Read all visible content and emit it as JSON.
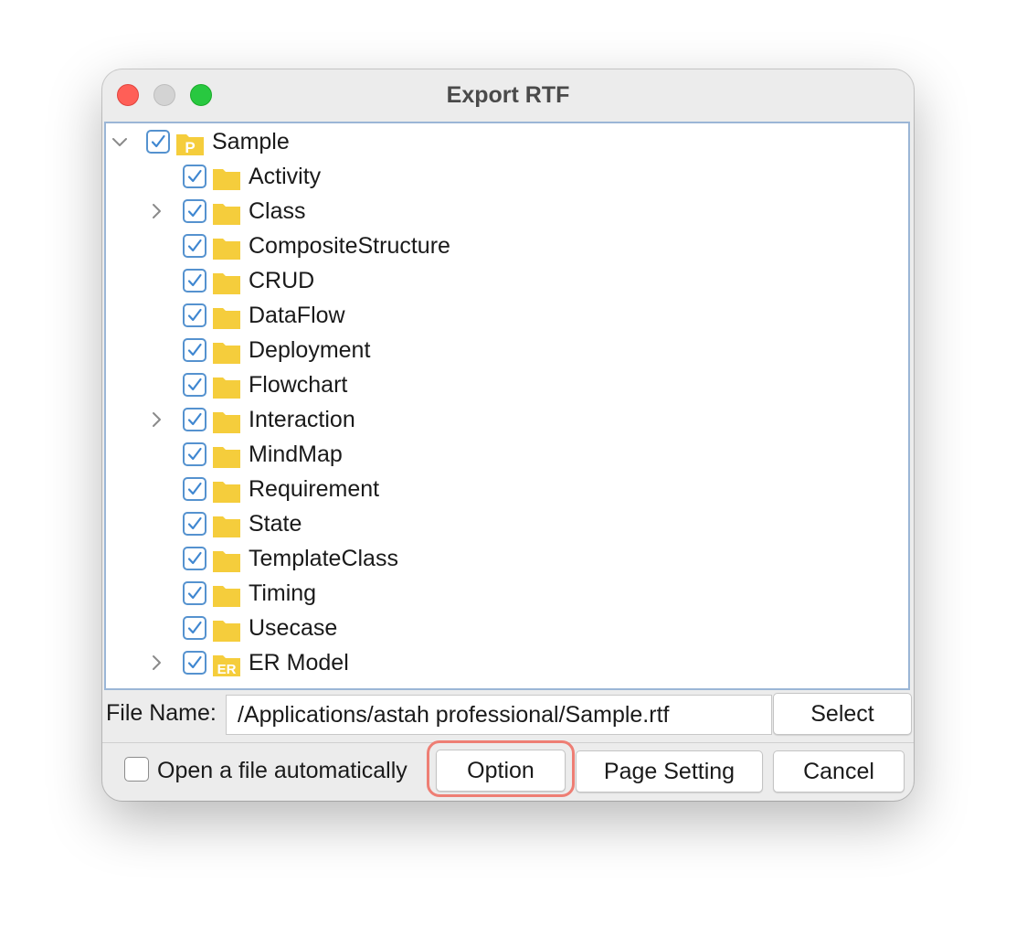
{
  "window": {
    "title": "Export RTF"
  },
  "tree": {
    "root": {
      "label": "Sample",
      "icon": "project-icon",
      "icon_letter": "P",
      "checked": true,
      "expanded": true
    },
    "items": [
      {
        "label": "Activity",
        "expandable": false,
        "checked": true,
        "icon": "folder-icon"
      },
      {
        "label": "Class",
        "expandable": true,
        "checked": true,
        "icon": "folder-icon"
      },
      {
        "label": "CompositeStructure",
        "expandable": false,
        "checked": true,
        "icon": "folder-icon"
      },
      {
        "label": "CRUD",
        "expandable": false,
        "checked": true,
        "icon": "folder-icon"
      },
      {
        "label": "DataFlow",
        "expandable": false,
        "checked": true,
        "icon": "folder-icon"
      },
      {
        "label": "Deployment",
        "expandable": false,
        "checked": true,
        "icon": "folder-icon"
      },
      {
        "label": "Flowchart",
        "expandable": false,
        "checked": true,
        "icon": "folder-icon"
      },
      {
        "label": "Interaction",
        "expandable": true,
        "checked": true,
        "icon": "folder-icon"
      },
      {
        "label": "MindMap",
        "expandable": false,
        "checked": true,
        "icon": "folder-icon"
      },
      {
        "label": "Requirement",
        "expandable": false,
        "checked": true,
        "icon": "folder-icon"
      },
      {
        "label": "State",
        "expandable": false,
        "checked": true,
        "icon": "folder-icon"
      },
      {
        "label": "TemplateClass",
        "expandable": false,
        "checked": true,
        "icon": "folder-icon"
      },
      {
        "label": "Timing",
        "expandable": false,
        "checked": true,
        "icon": "folder-icon"
      },
      {
        "label": "Usecase",
        "expandable": false,
        "checked": true,
        "icon": "folder-icon"
      },
      {
        "label": "ER Model",
        "expandable": true,
        "checked": true,
        "icon": "er-model-icon",
        "icon_letter": "ER"
      }
    ]
  },
  "file": {
    "label": "File Name:",
    "value": "/Applications/astah professional/Sample.rtf",
    "select_label": "Select"
  },
  "footer": {
    "open_auto_label": "Open a file automatically",
    "open_auto_checked": false,
    "option_label": "Option",
    "page_setting_label": "Page Setting",
    "cancel_label": "Cancel"
  },
  "colors": {
    "checkbox_border": "#5592cf",
    "folder_yellow": "#f5cd3c",
    "highlight": "#ee7e74",
    "tree_border": "#9bb6d6"
  }
}
